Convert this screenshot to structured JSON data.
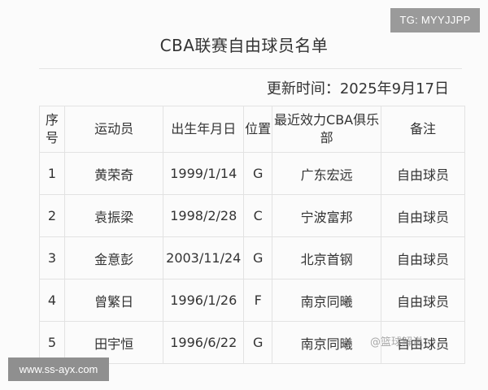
{
  "title": "CBA联赛自由球员名单",
  "badge": "TG: MYYJJPP",
  "update": "更新时间：2025年9月17日",
  "table": {
    "headers": [
      "序号",
      "运动员",
      "出生年月日",
      "位置",
      "最近效力CBA俱乐部",
      "备注"
    ],
    "rows": [
      [
        "1",
        "黄荣奇",
        "1999/1/14",
        "G",
        "广东宏远",
        "自由球员"
      ],
      [
        "2",
        "袁振梁",
        "1998/2/28",
        "C",
        "宁波富邦",
        "自由球员"
      ],
      [
        "3",
        "金意彭",
        "2003/11/24",
        "G",
        "北京首钢",
        "自由球员"
      ],
      [
        "4",
        "曾繁日",
        "1996/1/26",
        "F",
        "南京同曦",
        "自由球员"
      ],
      [
        "5",
        "田宇恒",
        "1996/6/22",
        "G",
        "南京同曦",
        "自由球员"
      ]
    ]
  },
  "watermark_left": "www.ss-ayx.com",
  "watermark_right": "@篮球解说"
}
